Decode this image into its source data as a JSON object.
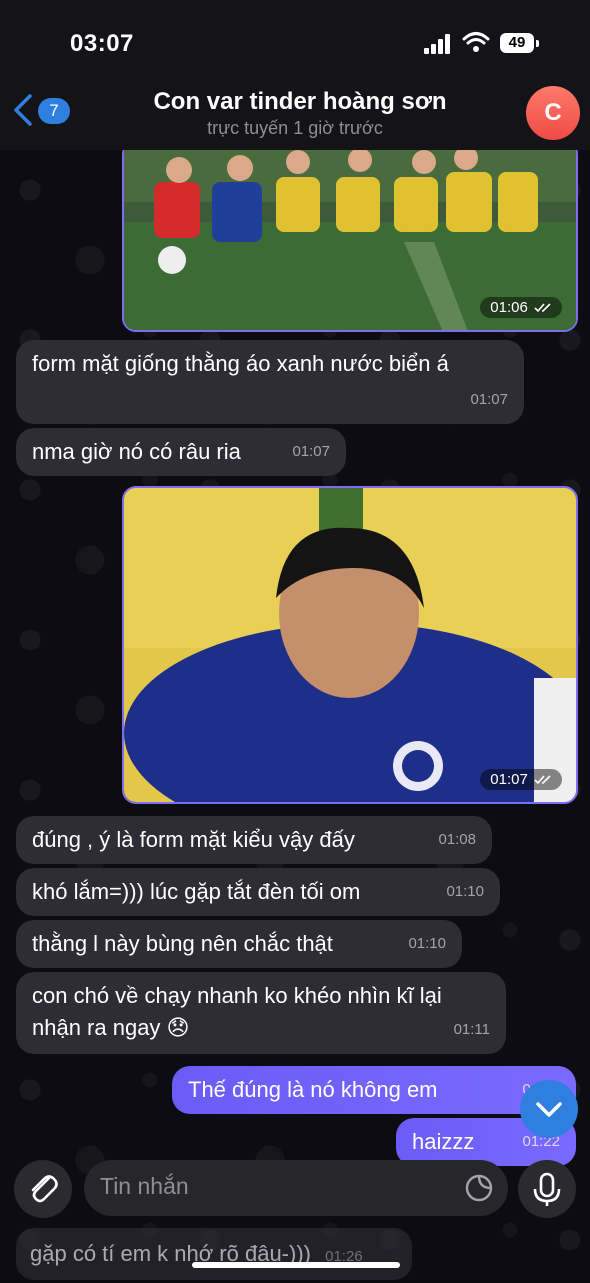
{
  "status": {
    "time": "03:07",
    "battery": "49"
  },
  "header": {
    "back_count": "7",
    "title": "Con var tinder hoàng sơn",
    "subtitle": "trực tuyến 1 giờ trước",
    "avatar_letter": "C"
  },
  "messages": [
    {
      "type": "photo",
      "time": "01:06",
      "direction": "out"
    },
    {
      "type": "text",
      "direction": "in",
      "text": "form mặt giống thằng áo xanh nước biển á",
      "time": "01:07"
    },
    {
      "type": "text",
      "direction": "in",
      "text": "nma giờ nó có râu ria",
      "time": "01:07"
    },
    {
      "type": "photo",
      "time": "01:07",
      "direction": "out"
    },
    {
      "type": "text",
      "direction": "in",
      "text": "đúng , ý là form mặt kiểu vậy đấy",
      "time": "01:08"
    },
    {
      "type": "text",
      "direction": "in",
      "text": "khó lắm=))) lúc gặp tắt đèn tối om",
      "time": "01:10"
    },
    {
      "type": "text",
      "direction": "in",
      "text": "thằng l này bùng nên chắc thật",
      "time": "01:10"
    },
    {
      "type": "text",
      "direction": "in",
      "text": "con chó về chạy nhanh ko khéo nhìn kĩ lại nhận ra ngay 😞",
      "time": "01:11"
    },
    {
      "type": "text",
      "direction": "out",
      "text": "Thế đúng là nó không em",
      "time": "01:22"
    },
    {
      "type": "text",
      "direction": "out",
      "text": "haizzz",
      "time": "01:22"
    },
    {
      "type": "text",
      "direction": "in",
      "text": "gặp có tí em k nhớ rõ đâu-)))",
      "time": "01:26"
    }
  ],
  "input": {
    "placeholder": "Tin nhắn"
  },
  "icons": {
    "back": "chevron-left-icon",
    "attach": "paperclip-icon",
    "sticker": "sticker-icon",
    "mic": "microphone-icon",
    "scroll": "chevron-down-icon"
  },
  "colors": {
    "outgoing_bubble": "#6d62ff",
    "incoming_bubble": "#2e2c34",
    "accent": "#2f7fe0",
    "avatar": "#ef4a44"
  }
}
